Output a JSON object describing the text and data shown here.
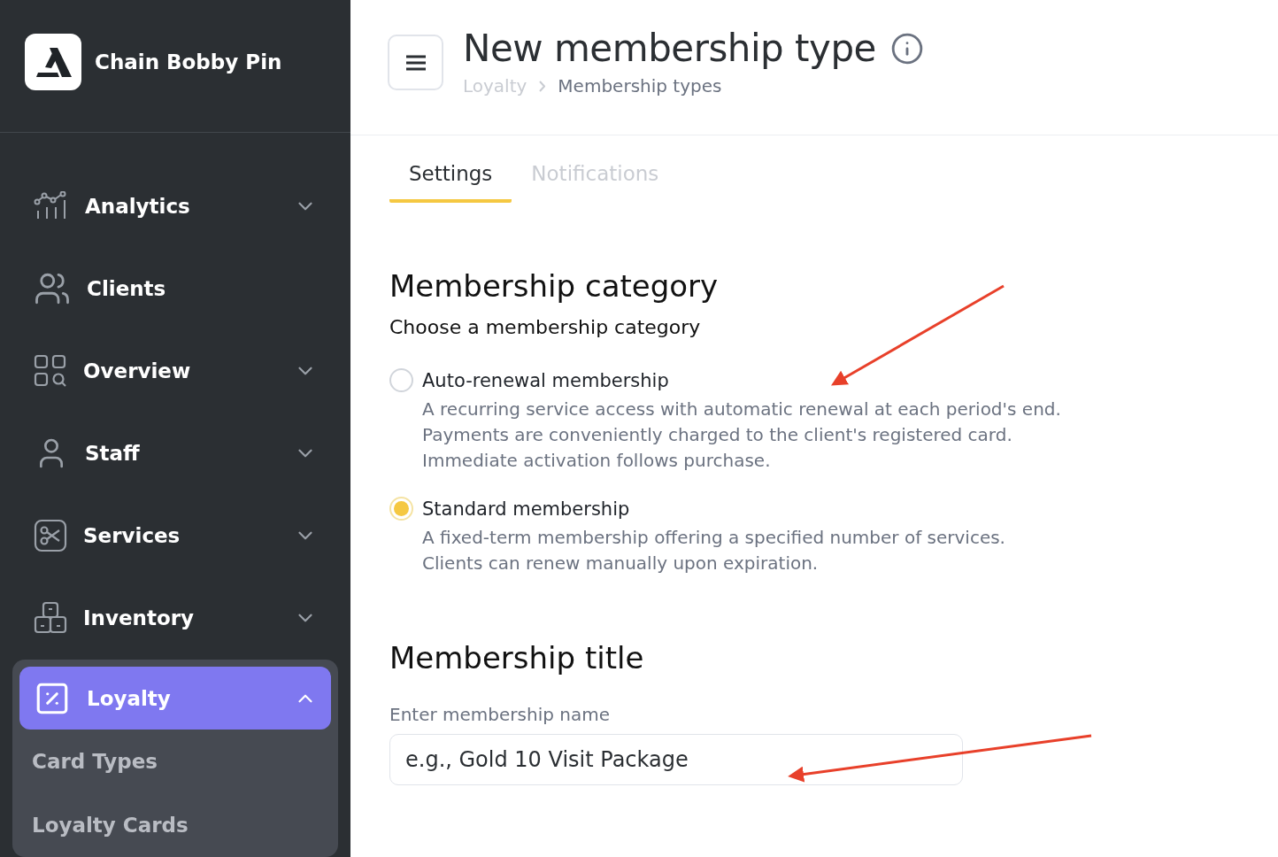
{
  "brand": {
    "name": "Chain Bobby Pin"
  },
  "sidebar": {
    "items": [
      {
        "label": "Analytics",
        "expanded": false,
        "selected": false
      },
      {
        "label": "Clients",
        "selected": false
      },
      {
        "label": "Overview",
        "expanded": false,
        "selected": false
      },
      {
        "label": "Staff",
        "expanded": false,
        "selected": false
      },
      {
        "label": "Services",
        "expanded": false,
        "selected": false
      },
      {
        "label": "Inventory",
        "expanded": false,
        "selected": false
      },
      {
        "label": "Loyalty",
        "expanded": true,
        "selected": true,
        "children": [
          {
            "label": "Card Types"
          },
          {
            "label": "Loyalty Cards"
          }
        ]
      }
    ]
  },
  "header": {
    "title": "New membership type",
    "breadcrumb": [
      "Loyalty",
      "Membership types"
    ]
  },
  "tabs": [
    {
      "label": "Settings",
      "selected": true
    },
    {
      "label": "Notifications",
      "selected": false
    }
  ],
  "category": {
    "heading": "Membership category",
    "subheading": "Choose a membership category",
    "options": [
      {
        "label": "Auto-renewal membership",
        "selected": false,
        "description": [
          "A recurring service access with automatic renewal at each period's end.",
          "Payments are conveniently charged to the client's registered card.",
          "Immediate activation follows purchase."
        ]
      },
      {
        "label": "Standard membership",
        "selected": true,
        "description": [
          "A fixed-term membership offering a specified number of services.",
          "Clients can renew manually upon expiration."
        ]
      }
    ]
  },
  "title_section": {
    "heading": "Membership title",
    "field_label": "Enter membership name",
    "placeholder": "e.g., Gold 10 Visit Package"
  }
}
